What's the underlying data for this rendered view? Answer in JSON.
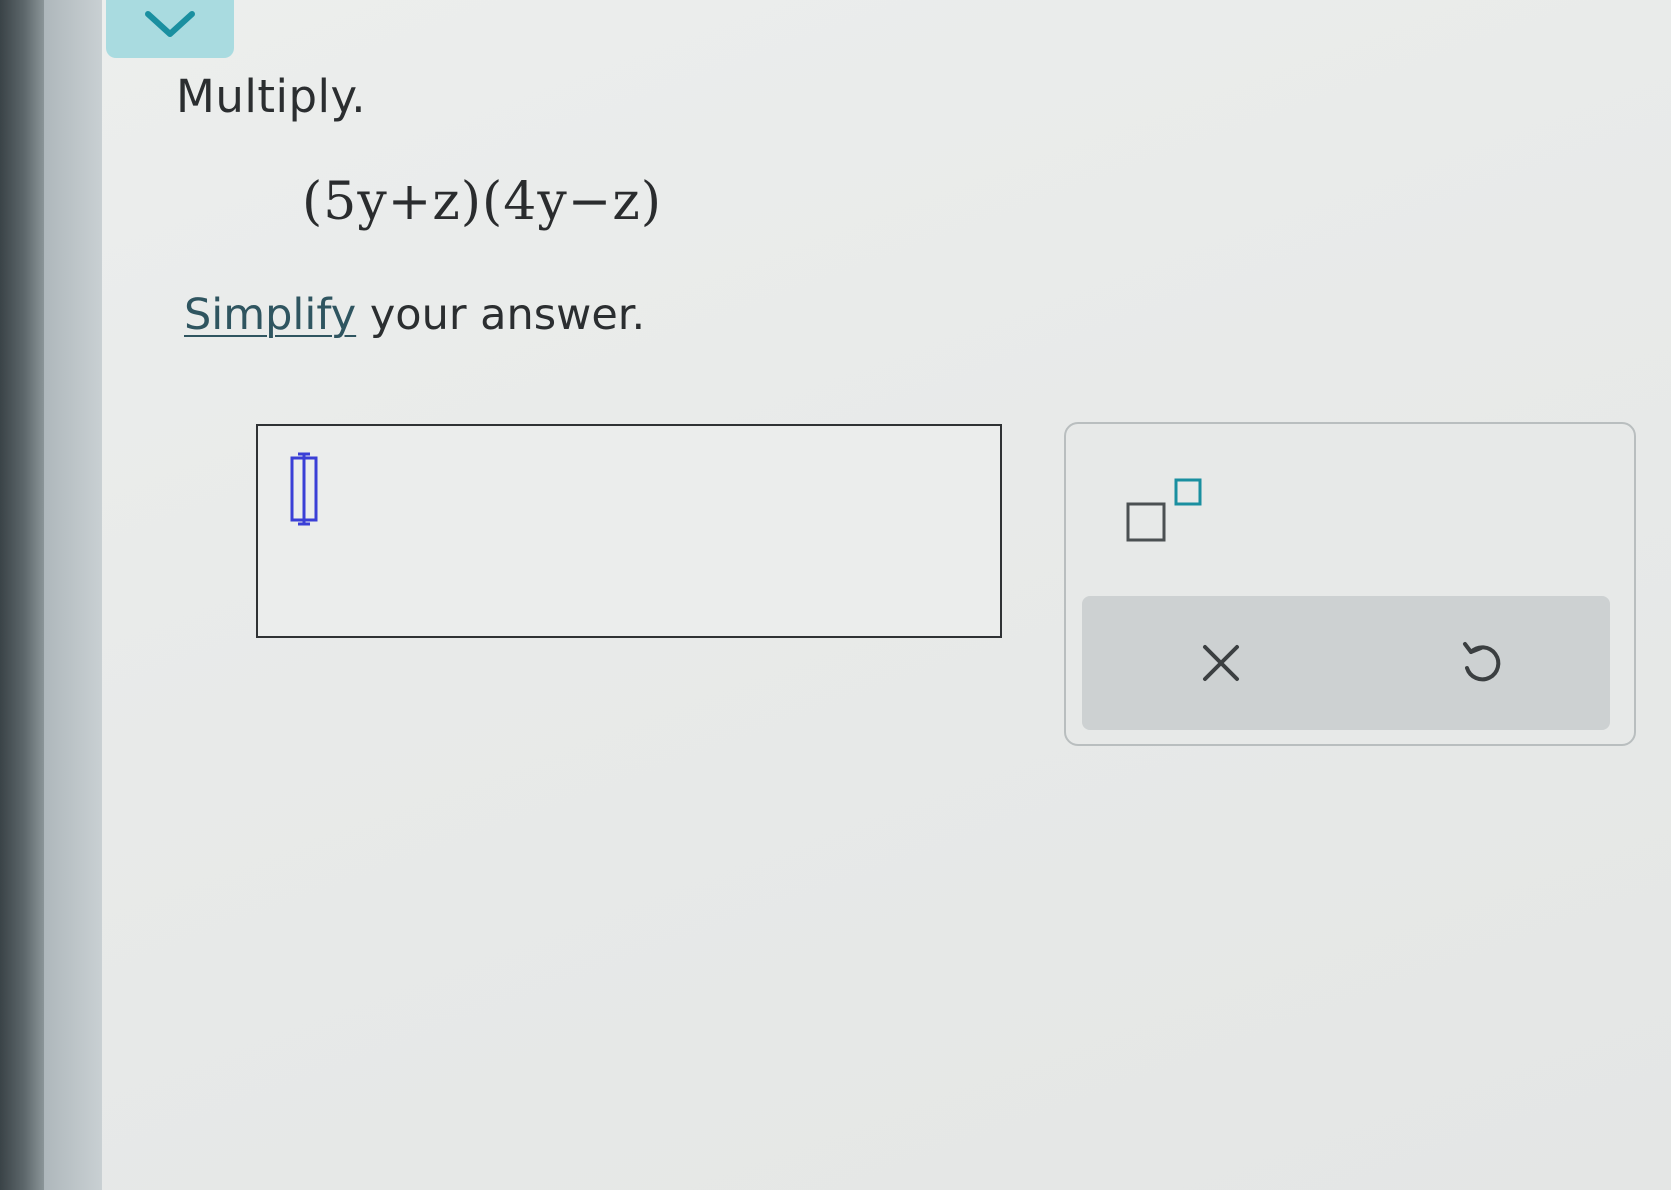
{
  "question": {
    "title": "Multiply.",
    "expression": "(5y+z)(4y−z)",
    "instruction_link": "Simplify",
    "instruction_rest": " your answer."
  },
  "answer": {
    "value": ""
  },
  "tools": {
    "exponent_icon": "exponent-template-icon",
    "clear_icon": "clear-x-icon",
    "undo_icon": "undo-icon"
  },
  "colors": {
    "accent_tab": "#a9dbe0",
    "accent_stroke": "#1a8fa0",
    "cursor_blue": "#3a3fd6"
  }
}
